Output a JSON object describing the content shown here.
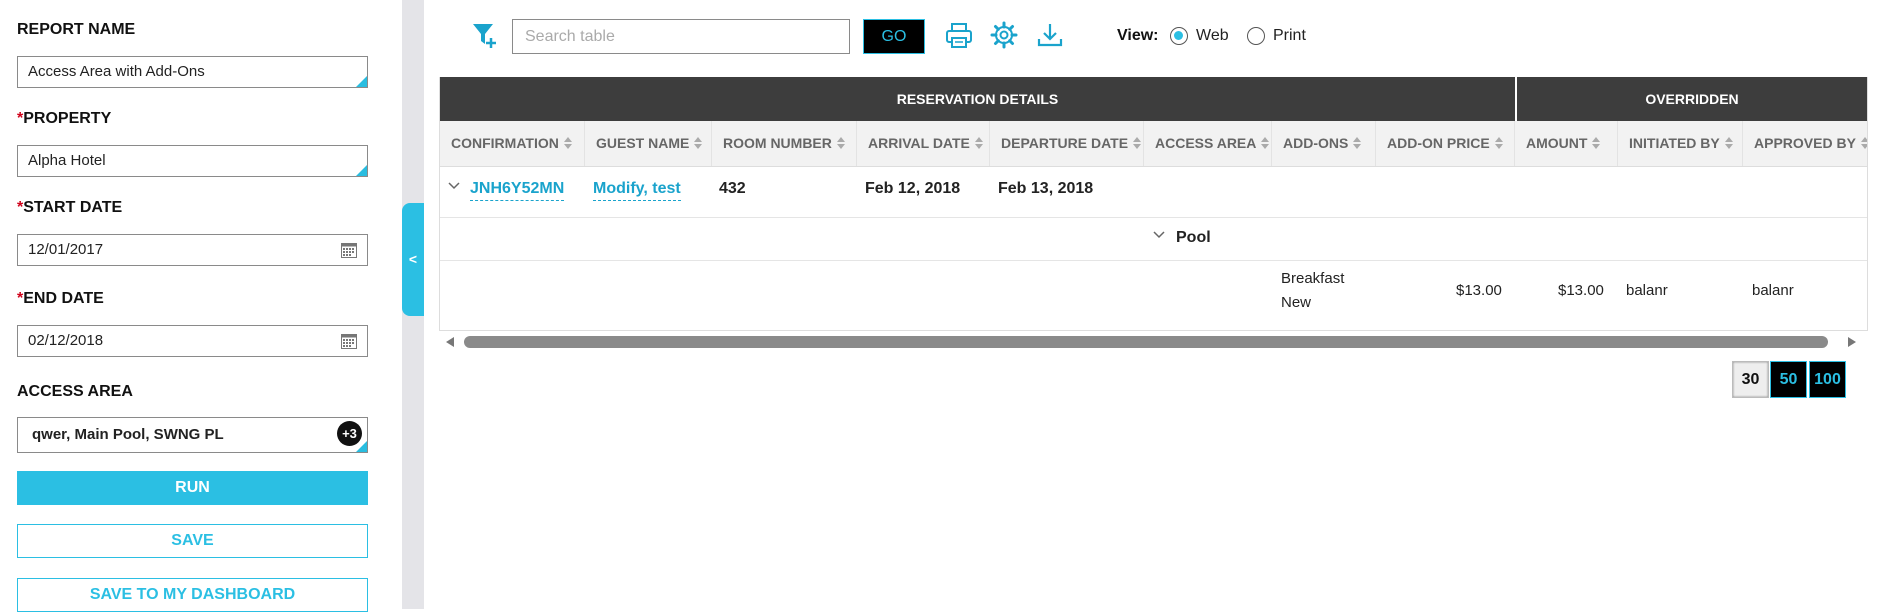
{
  "sidebar": {
    "report_name_label": "REPORT NAME",
    "report_name_value": "Access Area with Add-Ons",
    "property_label": "PROPERTY",
    "property_value": "Alpha Hotel",
    "start_date_label": "START DATE",
    "start_date_value": "12/01/2017",
    "end_date_label": "END DATE",
    "end_date_value": "02/12/2018",
    "access_area_label": "ACCESS AREA",
    "access_area_value": "qwer, Main Pool, SWNG PL",
    "access_area_more": "+3",
    "required_mark": "*",
    "run_label": "RUN",
    "save_label": "SAVE",
    "save_dashboard_label": "SAVE TO MY DASHBOARD",
    "collapse_glyph": "<"
  },
  "toolbar": {
    "search_placeholder": "Search table",
    "go_label": "GO",
    "view_label": "View:",
    "view_options": [
      "Web",
      "Print"
    ],
    "view_selected": "Web",
    "icons": [
      "filter-add-icon",
      "print-icon",
      "gear-icon",
      "download-icon"
    ]
  },
  "table": {
    "group_headers": [
      "RESERVATION DETAILS",
      "OVERRIDDEN"
    ],
    "columns": [
      "CONFIRMATION",
      "GUEST NAME",
      "ROOM NUMBER",
      "ARRIVAL DATE",
      "DEPARTURE DATE",
      "ACCESS AREA",
      "ADD-ONS",
      "ADD-ON PRICE",
      "AMOUNT",
      "INITIATED BY",
      "APPROVED BY"
    ],
    "reservation": {
      "confirmation": "JNH6Y52MN",
      "guest_name": "Modify, test",
      "room_number": "432",
      "arrival_date": "Feb 12, 2018",
      "departure_date": "Feb 13, 2018"
    },
    "access_area_group": "Pool",
    "addon_row": {
      "addon_line1": "Breakfast",
      "addon_line2": "New",
      "addon_price": "$13.00",
      "amount": "$13.00",
      "initiated_by": "balanr",
      "approved_by": "balanr"
    }
  },
  "pager": {
    "sizes": [
      "30",
      "50",
      "100"
    ],
    "selected": "30"
  },
  "colors": {
    "accent": "#2bbfe3",
    "link": "#1aa3cc",
    "header_dark": "#3d3d3d",
    "required": "#d0021b"
  }
}
